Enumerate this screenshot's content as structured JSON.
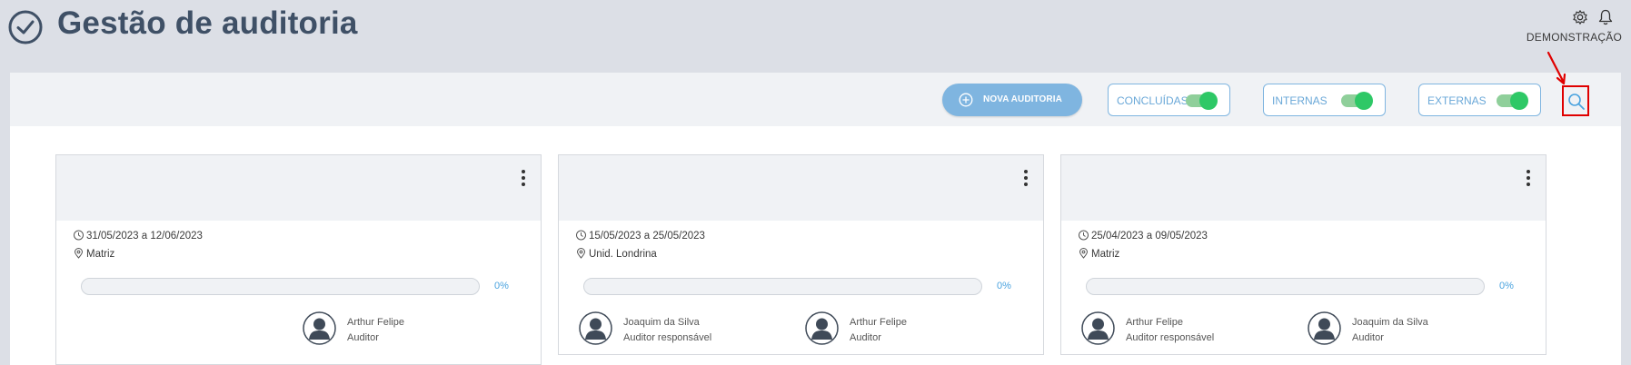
{
  "header": {
    "title": "Gestão de auditoria",
    "user_label": "DEMONSTRAÇÃO",
    "icons": {
      "title": "check-circle-icon",
      "settings": "gear-icon",
      "notifications": "bell-icon"
    }
  },
  "toolbar": {
    "new_audit_label": "NOVA AUDITORIA",
    "toggles": [
      {
        "label": "CONCLUÍDAS",
        "on": true
      },
      {
        "label": "INTERNAS",
        "on": true
      },
      {
        "label": "EXTERNAS",
        "on": true
      }
    ],
    "search_icon": "search-icon"
  },
  "colors": {
    "accent": "#7fb5e0",
    "toggle_on": "#2ec866",
    "title": "#3f5066",
    "highlight": "#e00000"
  },
  "cards": [
    {
      "dates": "31/05/2023 a 12/06/2023",
      "location": "Matriz",
      "progress": 0,
      "progress_label": "0%",
      "people": [
        {
          "name": "Arthur Felipe",
          "role": "Auditor"
        }
      ]
    },
    {
      "dates": "15/05/2023 a 25/05/2023",
      "location": "Unid. Londrina",
      "progress": 0,
      "progress_label": "0%",
      "people": [
        {
          "name": "Joaquim da Silva",
          "role": "Auditor responsável"
        },
        {
          "name": "Arthur Felipe",
          "role": "Auditor"
        }
      ]
    },
    {
      "dates": "25/04/2023 a 09/05/2023",
      "location": "Matriz",
      "progress": 0,
      "progress_label": "0%",
      "people": [
        {
          "name": "Arthur Felipe",
          "role": "Auditor responsável"
        },
        {
          "name": "Joaquim da Silva",
          "role": "Auditor"
        }
      ]
    }
  ]
}
